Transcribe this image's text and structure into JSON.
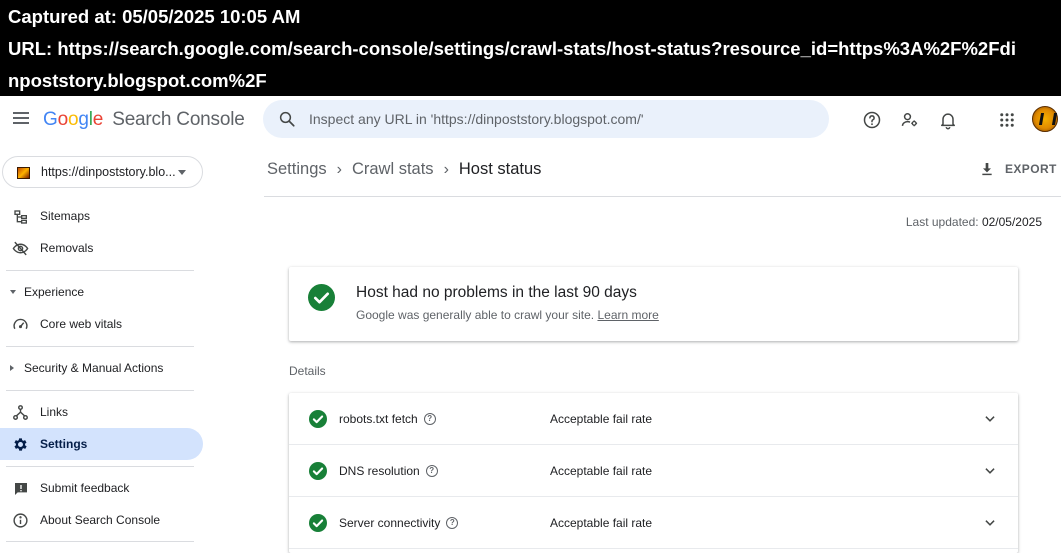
{
  "capture": {
    "captured_line": "Captured at: 05/05/2025 10:05 AM",
    "url_line_1": "URL: https://search.google.com/search-console/settings/crawl-stats/host-status?resource_id=https%3A%2F%2Fdi",
    "url_line_2": "npoststory.blogspot.com%2F"
  },
  "app": {
    "logo_letters": [
      "G",
      "o",
      "o",
      "g",
      "l",
      "e"
    ],
    "logo_colors": [
      "#4285F4",
      "#EA4335",
      "#FBBC05",
      "#4285F4",
      "#34A853",
      "#EA4335"
    ],
    "product": "Search Console",
    "search_placeholder": "Inspect any URL in 'https://dinpoststory.blogspot.com/'",
    "icons": [
      "menu-icon",
      "search-icon",
      "help-icon",
      "manage-users-icon",
      "notifications-icon",
      "apps-grid-icon"
    ]
  },
  "sidebar": {
    "property": "https://dinpoststory.blo...",
    "items": {
      "sitemaps": "Sitemaps",
      "removals": "Removals",
      "experience": "Experience",
      "core_web_vitals": "Core web vitals",
      "security": "Security & Manual Actions",
      "links": "Links",
      "settings": "Settings",
      "feedback": "Submit feedback",
      "about": "About Search Console"
    }
  },
  "main": {
    "breadcrumb": [
      "Settings",
      "Crawl stats",
      "Host status"
    ],
    "export_label": "EXPORT",
    "last_updated_label": "Last updated:",
    "last_updated_value": "02/05/2025",
    "status": {
      "title": "Host had no problems in the last 90 days",
      "subtitle": "Google was generally able to crawl your site.",
      "learn_more": "Learn more"
    },
    "details_label": "Details",
    "details": [
      {
        "name": "robots.txt fetch",
        "value": "Acceptable fail rate"
      },
      {
        "name": "DNS resolution",
        "value": "Acceptable fail rate"
      },
      {
        "name": "Server connectivity",
        "value": "Acceptable fail rate"
      }
    ],
    "colors": {
      "success_green": "#188038",
      "active_nav_bg": "#d3e3fd",
      "search_bg": "#eaf1fb"
    }
  }
}
